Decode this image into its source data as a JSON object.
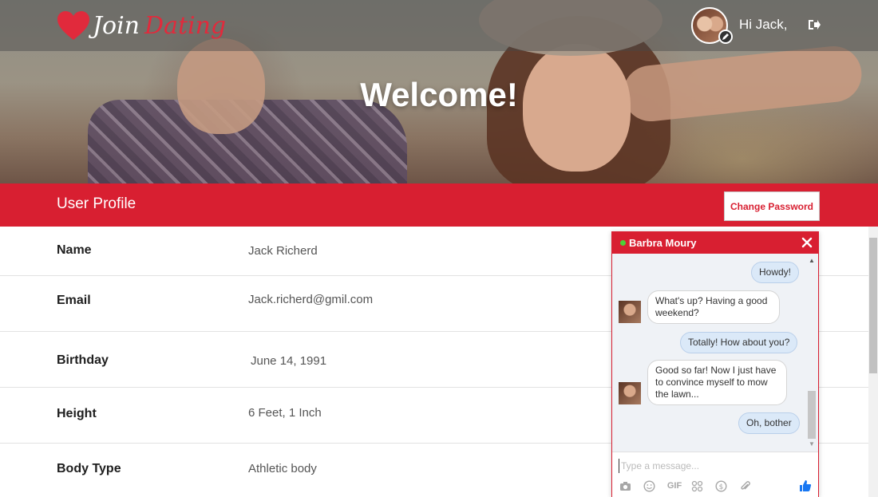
{
  "brand": {
    "join": "Join",
    "dating": "Dating"
  },
  "header": {
    "greeting": "Hi Jack,",
    "welcome": "Welcome!"
  },
  "profile": {
    "title": "User Profile",
    "change_password": "Change Password",
    "rows": [
      {
        "label": "Name",
        "value": "Jack Richerd"
      },
      {
        "label": "Email",
        "value": "Jack.richerd@gmil.com"
      },
      {
        "label": "Birthday",
        "value": "June  14, 1991"
      },
      {
        "label": "Height",
        "value": "6 Feet, 1 Inch"
      },
      {
        "label": "Body Type",
        "value": "Athletic body"
      }
    ]
  },
  "chat": {
    "contact": "Barbra Moury",
    "messages": [
      {
        "from": "me",
        "text": "Howdy!"
      },
      {
        "from": "them",
        "text": "What's up? Having a good weekend?"
      },
      {
        "from": "me",
        "text": "Totally! How about you?"
      },
      {
        "from": "them",
        "text": "Good so far! Now I just have to convince myself to mow the lawn..."
      },
      {
        "from": "me",
        "text": "Oh, bother"
      }
    ],
    "input_placeholder": "Type a message...",
    "tools": {
      "gif": "GIF"
    }
  },
  "colors": {
    "brand_red": "#d81f31",
    "online_green": "#4cd137",
    "bubble_out": "#dbe9f8",
    "like_blue": "#1877f2"
  },
  "icons": [
    "heart-icon",
    "edit-icon",
    "logout-icon",
    "close-icon",
    "camera-icon",
    "emoji-icon",
    "gif-icon",
    "sticker-icon",
    "dollar-icon",
    "attachment-icon",
    "thumbs-up-icon"
  ]
}
